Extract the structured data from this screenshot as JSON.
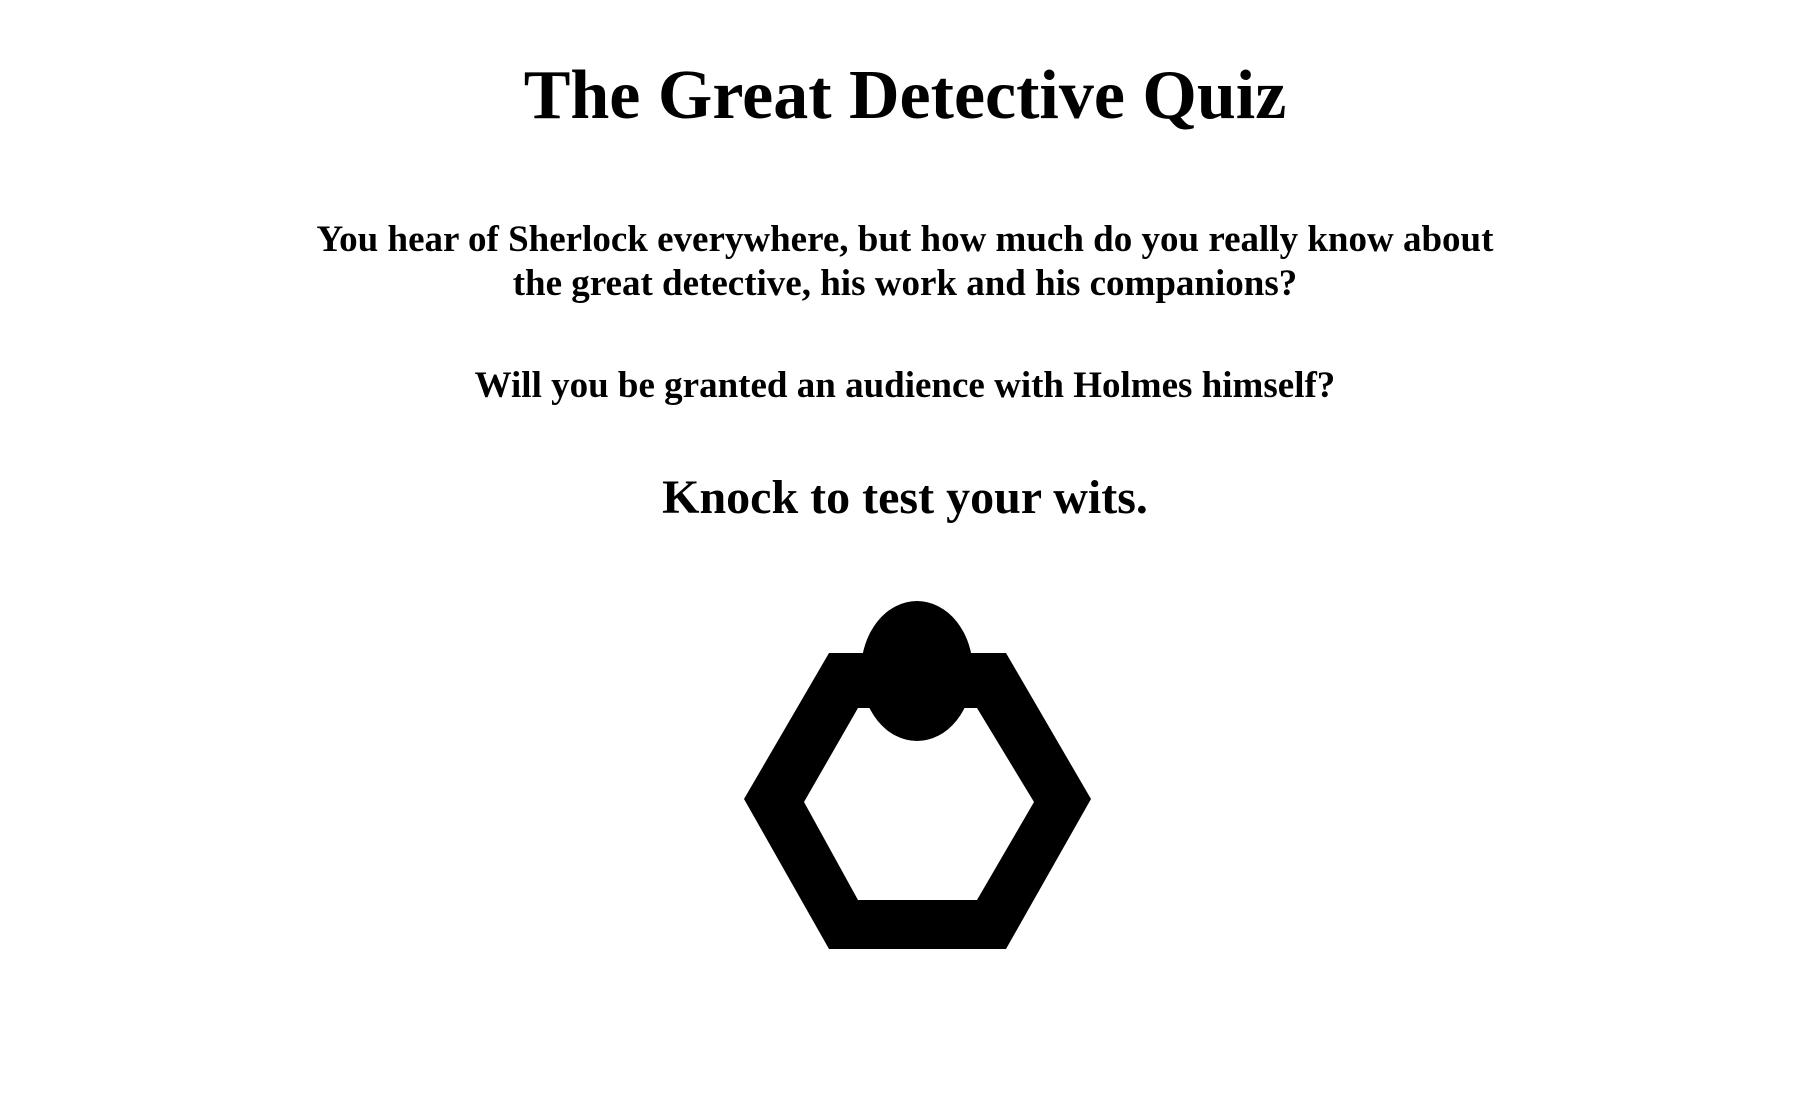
{
  "page": {
    "title": "The Great Detective Quiz",
    "intro": "You hear of Sherlock everywhere, but how much do you really know about the great detective, his work and his companions?",
    "question": "Will you be granted an audience with Holmes himself?",
    "cta": "Knock to test your wits."
  },
  "knocker": {
    "icon": "door-knocker-icon",
    "color": "#000000"
  }
}
